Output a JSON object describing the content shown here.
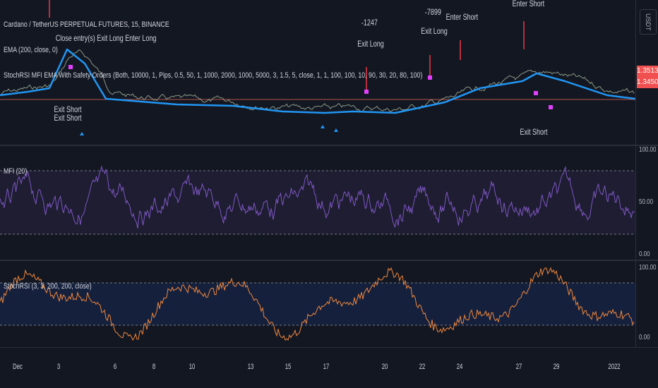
{
  "header": {
    "symbol": "Cardano / TetherUS PERPETUAL FUTURES, 15, BINANCE",
    "ema": "EMA (200, close, 0)",
    "strategy": "StochRSI MFI EMA With Safety Orders (Both, 10000, 1, Pips, 0.5, 50, 1, 1000, 2000, 1000, 5000, 3, 1.5, 5, close, 1, 1, 100, 100, 10, 90, 30, 20, 80, 100)"
  },
  "currency": "USDT",
  "prices": {
    "tag1": "1.3513",
    "tag2": "1.3450"
  },
  "annotations": [
    "Close entry(s) Exit Long Enter Long",
    "-1247",
    "Exit Long",
    "-7899",
    "Exit Long",
    "Enter Short",
    "Enter Short",
    "Exit Short",
    "Exit Short",
    "Exit Short"
  ],
  "mfi": {
    "title": "MFI (20)",
    "axis": [
      "100.00",
      "50.00",
      "0.00"
    ]
  },
  "stoch": {
    "title": "StochRSI (3, 3, 200, 200, close)",
    "axis": [
      "100.00",
      "0.00"
    ]
  },
  "time_axis": [
    "Dec",
    "3",
    "6",
    "8",
    "10",
    "13",
    "15",
    "17",
    "20",
    "22",
    "24",
    "27",
    "29",
    "2022"
  ],
  "colors": {
    "ema": "#2196f3",
    "mfi": "#7e57c2",
    "stoch": "#f0883e",
    "bg": "#131722",
    "tag": "#f0504f",
    "marker": "#e040fb",
    "short": "#f23645"
  }
}
